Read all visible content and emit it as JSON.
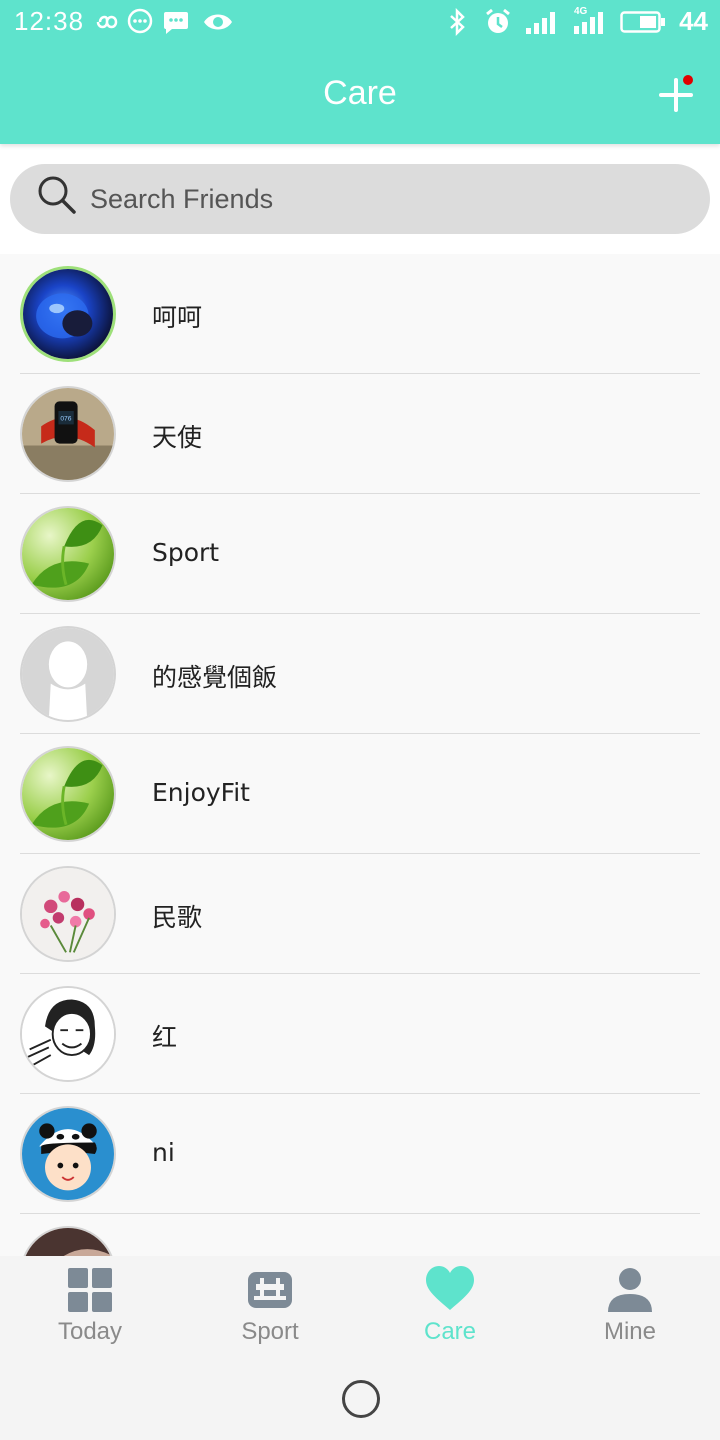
{
  "status_bar": {
    "time": "12:38",
    "battery": "44",
    "network_label": "4G"
  },
  "header": {
    "title": "Care",
    "add_icon": "plus-icon",
    "notification_dot_color": "#e00000"
  },
  "search": {
    "placeholder": "Search Friends"
  },
  "friends": [
    {
      "name": "呵呵",
      "avatar": "blue-object-photo"
    },
    {
      "name": "天使",
      "avatar": "fitness-band-photo"
    },
    {
      "name": "Sport",
      "avatar": "green-leaf-photo"
    },
    {
      "name": "的感覺個飯",
      "avatar": "default-person-avatar"
    },
    {
      "name": "EnjoyFit",
      "avatar": "green-leaf-photo"
    },
    {
      "name": "民歌",
      "avatar": "flowers-photo"
    },
    {
      "name": "红",
      "avatar": "meme-face-drawing"
    },
    {
      "name": "ni",
      "avatar": "panda-hat-cartoon"
    },
    {
      "name": "",
      "avatar": "portrait-photo"
    }
  ],
  "nav": {
    "tabs": [
      {
        "label": "Today",
        "icon": "grid-icon"
      },
      {
        "label": "Sport",
        "icon": "dumbbell-icon"
      },
      {
        "label": "Care",
        "icon": "heart-icon"
      },
      {
        "label": "Mine",
        "icon": "person-icon"
      }
    ],
    "active": "Care"
  },
  "colors": {
    "accent": "#5ee3cc",
    "icon_gray": "#7d8a96"
  }
}
